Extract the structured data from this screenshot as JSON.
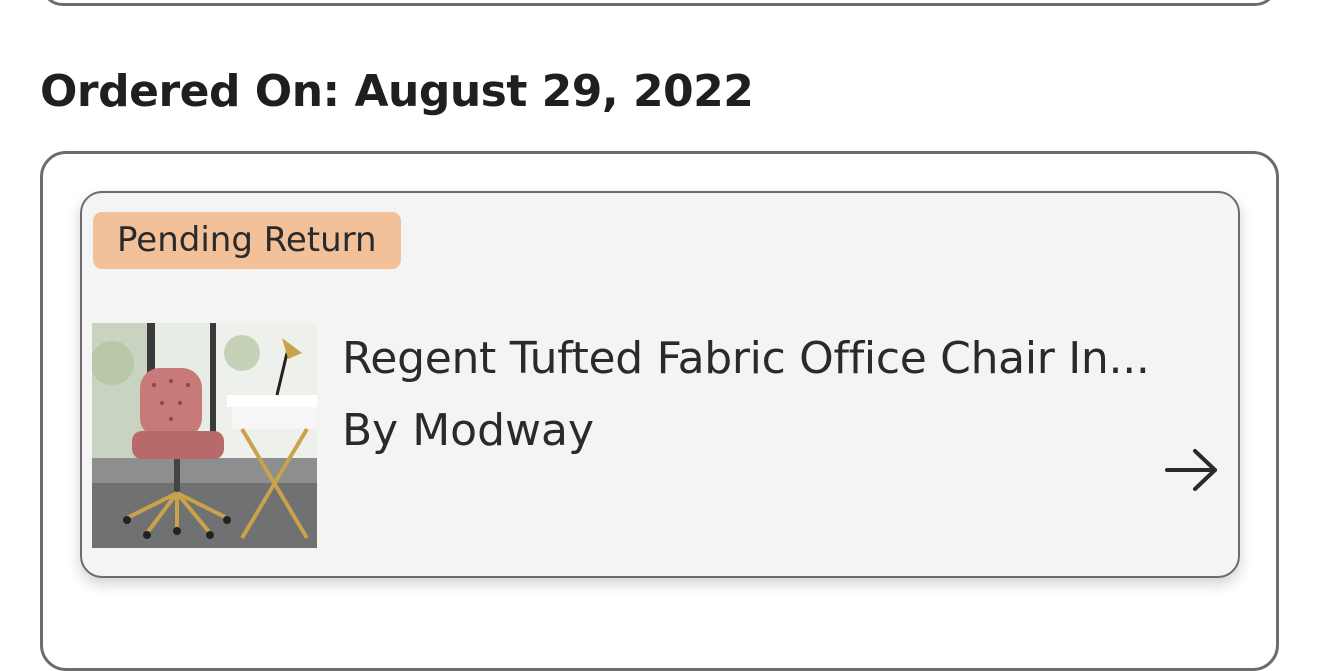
{
  "order": {
    "date_label": "Ordered On: August 29, 2022"
  },
  "item": {
    "status": "Pending Return",
    "name": "Regent Tufted Fabric Office Chair In...",
    "brand": "By Modway",
    "image_icon": "office-chair-photo",
    "arrow_icon": "arrow-right-icon"
  },
  "colors": {
    "badge": "#f2c19a",
    "border": "#6e6a70",
    "card_bg": "#f4f4f4"
  }
}
